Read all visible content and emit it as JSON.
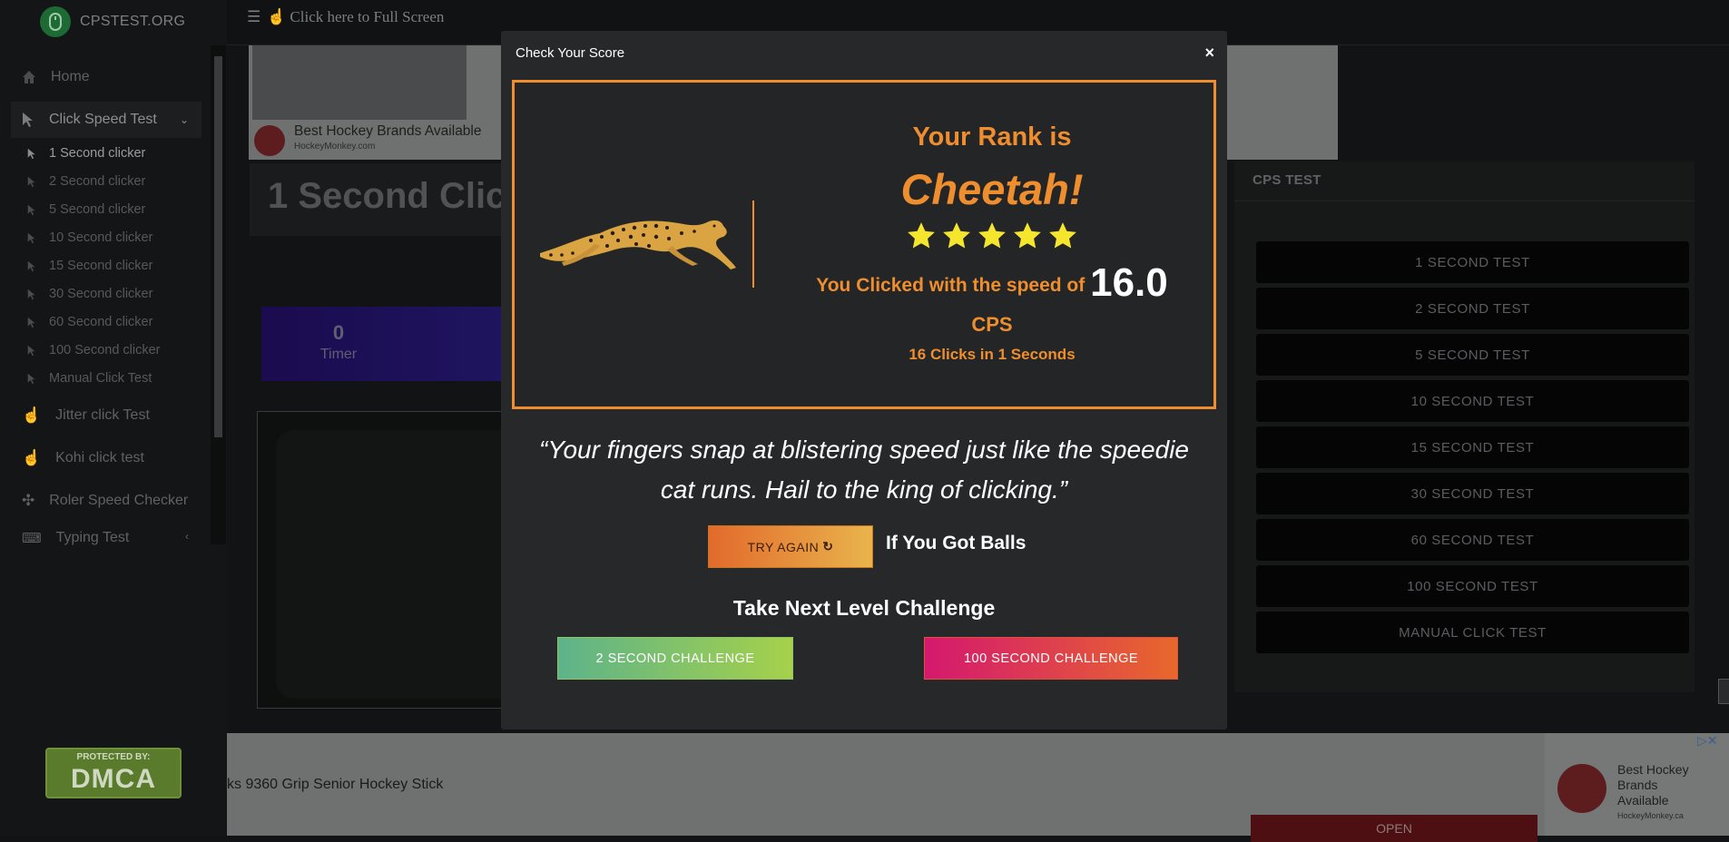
{
  "brand": {
    "name": "CPSTEST.ORG"
  },
  "topbar": {
    "fullscreen_label": "☝ Click here to Full Screen"
  },
  "sidebar": {
    "items": [
      {
        "label": "Home",
        "icon": "home-icon"
      },
      {
        "label": "Click Speed Test",
        "icon": "cursor-icon"
      },
      {
        "label": "Jitter click Test",
        "icon": "hand-icon"
      },
      {
        "label": "Kohi click test",
        "icon": "hand-icon"
      },
      {
        "label": "Roler Speed Checker",
        "icon": "crosshair-icon"
      },
      {
        "label": "Typing Test",
        "icon": "keyboard-icon"
      }
    ],
    "subitems": [
      "1 Second clicker",
      "2 Second clicker",
      "5 Second clicker",
      "10 Second clicker",
      "15 Second clicker",
      "30 Second clicker",
      "60 Second clicker",
      "100 Second clicker",
      "Manual Click Test"
    ],
    "dmca": {
      "top": "PROTECTED BY:",
      "main": "DMCA"
    }
  },
  "ad_top": {
    "caption": "Best Hockey Brands Available",
    "source": "HockeyMonkey.com"
  },
  "main": {
    "title": "1 Second Clic",
    "timer_value": "0",
    "timer_label": "Timer"
  },
  "cps_panel": {
    "heading": "CPS TEST",
    "tests": [
      "1 SECOND TEST",
      "2 SECOND TEST",
      "5 SECOND TEST",
      "10 SECOND TEST",
      "15 SECOND TEST",
      "30 SECOND TEST",
      "60 SECOND TEST",
      "100 SECOND TEST",
      "MANUAL CLICK TEST"
    ]
  },
  "ad_bottom": {
    "text": "ks 9360 Grip Senior Hockey Stick",
    "open": "OPEN",
    "side_text": "Best Hockey Brands Available",
    "side_source": "HockeyMonkey.ca"
  },
  "modal": {
    "title": "Check Your Score",
    "close": "×",
    "rank_label": "Your Rank is",
    "rank_name": "Cheetah!",
    "stars": 5,
    "speed_prefix": "You Clicked with the speed of",
    "speed_value": "16.0",
    "speed_unit": "CPS",
    "clicks_summary": "16 Clicks in 1 Seconds",
    "quote": "“Your fingers snap at blistering speed just like the speedie\ncat runs. Hail to the king of clicking.”",
    "try_again": "TRY AGAIN",
    "try_icon": "refresh-icon",
    "balls_text": "If You Got Balls",
    "next_level": "Take Next Level Challenge",
    "challenge_2": "2 SECOND CHALLENGE",
    "challenge_100": "100 SECOND CHALLENGE",
    "accent_color": "#ef8e2e",
    "star_color": "#f5e62d"
  }
}
